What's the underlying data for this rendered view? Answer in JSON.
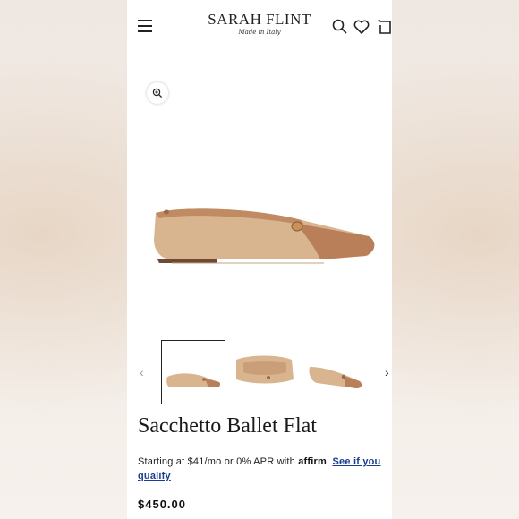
{
  "header": {
    "logo_main": "SARAH FLINT",
    "logo_sub": "Made in Italy",
    "icons": [
      "menu-icon",
      "search-icon",
      "heart-icon",
      "cart-icon"
    ]
  },
  "gallery": {
    "zoom_icon": "magnify-plus-icon",
    "thumbnails": [
      {
        "selected": true
      },
      {
        "selected": false
      },
      {
        "selected": false
      }
    ],
    "prev_arrow": "‹",
    "next_arrow": "›"
  },
  "product": {
    "title": "Sacchetto Ballet Flat",
    "financing_prefix": "Starting at $41/mo or 0% APR with ",
    "financing_brand": "affirm",
    "financing_period": ".",
    "financing_link": "See if you qualify",
    "price": "$450.00"
  },
  "colors": {
    "shoe_tan": "#d8b48f",
    "shoe_toe": "#b97f59",
    "link": "#1a3d8f"
  }
}
